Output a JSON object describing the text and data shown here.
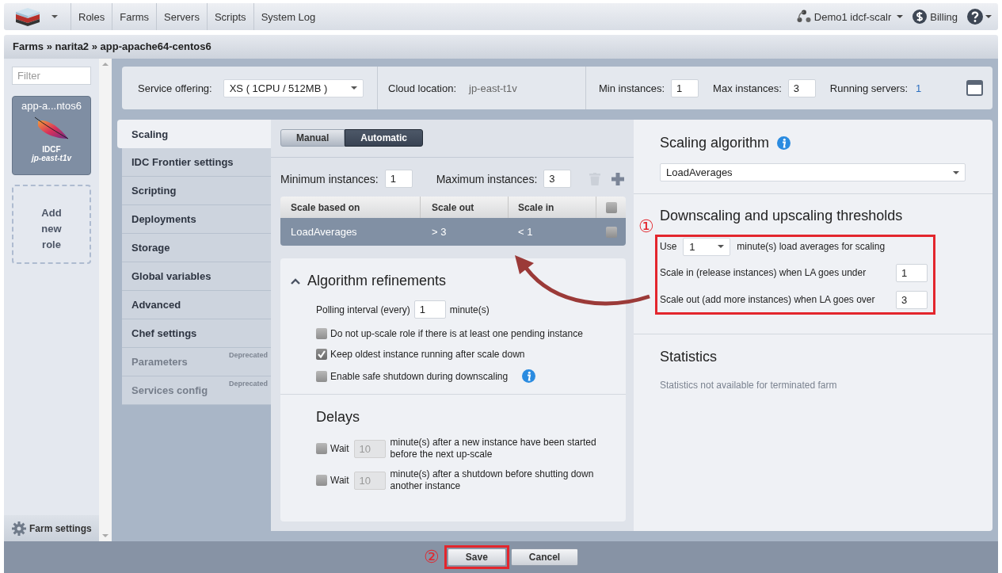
{
  "top_nav": {
    "menu": [
      {
        "label": "Roles"
      },
      {
        "label": "Farms"
      },
      {
        "label": "Servers"
      },
      {
        "label": "Scripts"
      },
      {
        "label": "System Log"
      }
    ],
    "account": "Demo1 idcf-scalr",
    "billing": "Billing"
  },
  "breadcrumb": "Farms » narita2 » app-apache64-centos6",
  "sidebar": {
    "filter_placeholder": "Filter",
    "roles": [
      {
        "name": "app-a...ntos6",
        "cloud": "IDCF",
        "location": "jp-east-t1v",
        "selected": true
      }
    ],
    "add_role": "Add new role",
    "farm_settings": "Farm settings"
  },
  "role_settings": {
    "service_offering": {
      "label": "Service offering:",
      "value": "XS ( 1CPU / 512MB )"
    },
    "cloud_location": {
      "label": "Cloud location:",
      "value": "jp-east-t1v"
    },
    "min_instances": {
      "label": "Min instances:",
      "value": "1"
    },
    "max_instances": {
      "label": "Max instances:",
      "value": "3"
    },
    "running_servers": {
      "label": "Running servers:",
      "value": "1"
    }
  },
  "tabs": [
    {
      "label": "Scaling",
      "selected": true,
      "disabled": false
    },
    {
      "label": "IDC Frontier settings",
      "selected": false,
      "disabled": false
    },
    {
      "label": "Scripting",
      "selected": false,
      "disabled": false
    },
    {
      "label": "Deployments",
      "selected": false,
      "disabled": false
    },
    {
      "label": "Storage",
      "selected": false,
      "disabled": false
    },
    {
      "label": "Global variables",
      "selected": false,
      "disabled": false
    },
    {
      "label": "Advanced",
      "selected": false,
      "disabled": false
    },
    {
      "label": "Chef settings",
      "selected": false,
      "disabled": false
    },
    {
      "label": "Parameters",
      "selected": false,
      "disabled": true,
      "badge": "Deprecated"
    },
    {
      "label": "Services config",
      "selected": false,
      "disabled": true,
      "badge": "Deprecated"
    }
  ],
  "scaling": {
    "modes": [
      {
        "label": "Manual",
        "selected": false
      },
      {
        "label": "Automatic",
        "selected": true
      }
    ],
    "min_instances": {
      "label": "Minimum instances:",
      "value": "1"
    },
    "max_instances": {
      "label": "Maximum instances:",
      "value": "3"
    },
    "table": {
      "columns": [
        "Scale based on",
        "Scale out",
        "Scale in"
      ],
      "all_checked": false,
      "rows": [
        {
          "cells": [
            "LoadAverages",
            "> 3",
            "< 1"
          ],
          "selected": true,
          "checked": false
        }
      ]
    }
  },
  "refinements": {
    "title": "Algorithm refinements",
    "expanded": true,
    "polling": {
      "label": "Polling interval (every)",
      "value": "1",
      "unit": "minute(s)"
    },
    "options": [
      {
        "label": "Do not up-scale role if there is at least one pending instance",
        "checked": false,
        "info": false
      },
      {
        "label": "Keep oldest instance running after scale down",
        "checked": true,
        "info": false
      },
      {
        "label": "Enable safe shutdown during downscaling",
        "checked": false,
        "info": true
      }
    ]
  },
  "delays": {
    "title": "Delays",
    "items": [
      {
        "checked": false,
        "label": "Wait",
        "value": "10",
        "disabled": true,
        "text": "minute(s) after a new instance have been started before the next up-scale"
      },
      {
        "checked": false,
        "label": "Wait",
        "value": "10",
        "disabled": true,
        "text": "minute(s) after a shutdown before shutting down another instance"
      }
    ]
  },
  "algorithm": {
    "title": "Scaling algorithm",
    "value": "LoadAverages"
  },
  "thresholds": {
    "title": "Downscaling and upscaling thresholds",
    "marker": "①",
    "use": {
      "label": "Use",
      "value": "1",
      "text": "minute(s) load averages for scaling"
    },
    "rows": [
      {
        "label": "Scale in (release instances) when LA goes under",
        "value": "1"
      },
      {
        "label": "Scale out (add more instances) when LA goes over",
        "value": "3"
      }
    ]
  },
  "statistics": {
    "title": "Statistics",
    "text": "Statistics not available for terminated farm"
  },
  "footer": {
    "marker": "②",
    "buttons": [
      {
        "label": "Save",
        "highlighted": true
      },
      {
        "label": "Cancel",
        "highlighted": false
      }
    ]
  }
}
